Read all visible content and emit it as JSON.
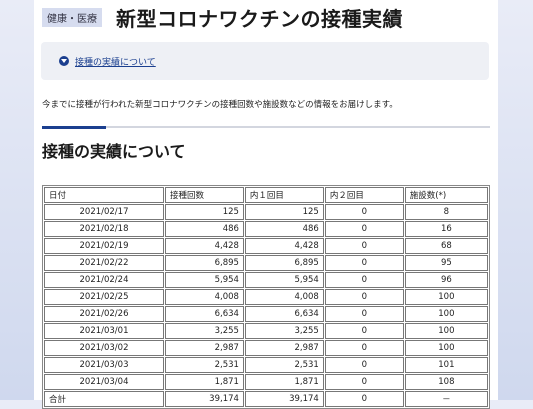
{
  "header": {
    "category_tag": "健康・医療",
    "title": "新型コロナワクチンの接種実績"
  },
  "toc": {
    "link_label": "接種の実績について"
  },
  "intro_text": "今までに接種が行われた新型コロナワクチンの接種回数や施設数などの情報をお届けします。",
  "section_heading": "接種の実績について",
  "table": {
    "headers": [
      "日付",
      "接種回数",
      "内１回目",
      "内２回目",
      "施設数(*)"
    ],
    "rows": [
      [
        "2021/02/17",
        "125",
        "125",
        "0",
        "8"
      ],
      [
        "2021/02/18",
        "486",
        "486",
        "0",
        "16"
      ],
      [
        "2021/02/19",
        "4,428",
        "4,428",
        "0",
        "68"
      ],
      [
        "2021/02/22",
        "6,895",
        "6,895",
        "0",
        "95"
      ],
      [
        "2021/02/24",
        "5,954",
        "5,954",
        "0",
        "96"
      ],
      [
        "2021/02/25",
        "4,008",
        "4,008",
        "0",
        "100"
      ],
      [
        "2021/02/26",
        "6,634",
        "6,634",
        "0",
        "100"
      ],
      [
        "2021/03/01",
        "3,255",
        "3,255",
        "0",
        "100"
      ],
      [
        "2021/03/02",
        "2,987",
        "2,987",
        "0",
        "100"
      ],
      [
        "2021/03/03",
        "2,531",
        "2,531",
        "0",
        "101"
      ],
      [
        "2021/03/04",
        "1,871",
        "1,871",
        "0",
        "108"
      ]
    ],
    "total_row": [
      "合計",
      "39,174",
      "39,174",
      "0",
      "－"
    ]
  },
  "colors": {
    "accent": "#1b3f8f",
    "tag_bg": "#d6dcef",
    "toc_bg": "#eef0f5"
  }
}
